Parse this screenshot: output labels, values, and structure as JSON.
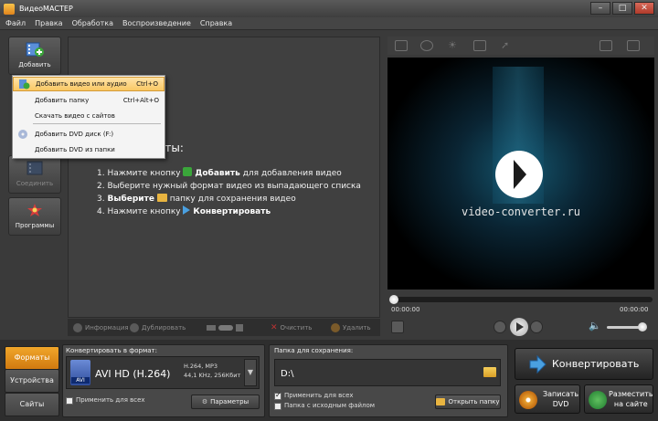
{
  "window": {
    "title": "ВидеоМАСТЕР",
    "controls": [
      "–",
      "□",
      "✕"
    ]
  },
  "menu": [
    "Файл",
    "Правка",
    "Обработка",
    "Воспроизведение",
    "Справка"
  ],
  "left_tools": {
    "add": "Добавить",
    "join": "Соединить",
    "programs": "Программы"
  },
  "dropdown": {
    "items": [
      {
        "label": "Добавить видео или аудио",
        "shortcut": "Ctrl+O"
      },
      {
        "label": "Добавить папку",
        "shortcut": "Ctrl+Alt+O"
      },
      {
        "label": "Скачать видео с сайтов",
        "shortcut": ""
      },
      {
        "label": "Добавить DVD диск (F:)",
        "shortcut": ""
      },
      {
        "label": "Добавить DVD из папки",
        "shortcut": ""
      }
    ]
  },
  "instructions": {
    "title_partial": "аты:",
    "step1_a": "1. Нажмите кнопку",
    "step1_b": "Добавить",
    "step1_c": "для добавления видео",
    "step2": "2. Выберите нужный формат видео из выпадающего списка",
    "step3_a": "3.",
    "step3_b": "Выберите",
    "step3_c": "папку для сохранения видео",
    "step4_a": "4. Нажмите кнопку",
    "step4_b": "Конвертировать"
  },
  "list_toolbar": {
    "info": "Информация",
    "duplicate": "Дублировать",
    "clear": "Очистить",
    "delete": "Удалить"
  },
  "preview": {
    "watermark": "video-converter.ru",
    "time_start": "00:00:00",
    "time_end": "00:00:00"
  },
  "tabs": [
    "Форматы",
    "Устройства",
    "Сайты"
  ],
  "format_panel": {
    "label": "Конвертировать в формат:",
    "format_name": "AVI HD (H.264)",
    "icon_text": "AVI",
    "meta_line1": "H.264, MP3",
    "meta_line2": "44,1 KHz, 256Кбит",
    "apply_all": "Применить для всех",
    "params_button": "Параметры"
  },
  "folder_panel": {
    "label": "Папка для сохранения:",
    "path": "D:\\",
    "apply_all": "Применить для всех",
    "source_folder": "Папка с исходным файлом",
    "open_button": "Открыть папку"
  },
  "actions": {
    "convert": "Конвертировать",
    "burn_dvd_1": "Записать",
    "burn_dvd_2": "DVD",
    "publish_1": "Разместить",
    "publish_2": "на сайте"
  },
  "colors": {
    "accent_orange": "#e08a18",
    "menu_highlight": "#f9c864",
    "preview_glow": "#15566e"
  }
}
